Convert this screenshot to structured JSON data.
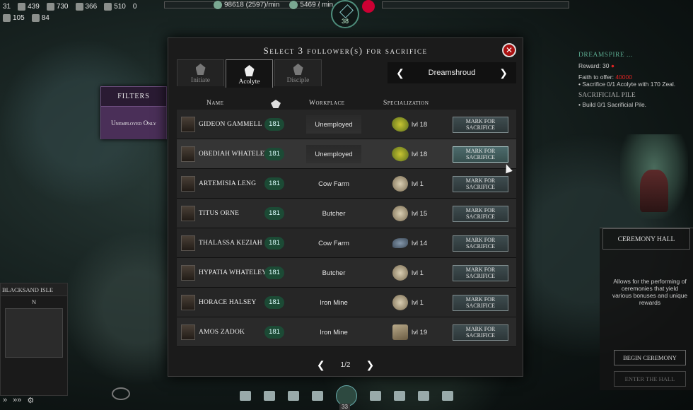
{
  "resources": {
    "r1": "31",
    "r2": "439",
    "r3": "730",
    "r4": "366",
    "r5": "510",
    "r6": "0",
    "r7": "105",
    "r8": "84",
    "income1": "98618 (2597)/min",
    "income2": "5469 / min",
    "compass_value": "38"
  },
  "dialog": {
    "title": "Select 3 follower(s) for sacrifice",
    "close_icon": "close-icon",
    "tabs": [
      {
        "label": "Initiate"
      },
      {
        "label": "Acolyte"
      },
      {
        "label": "Disciple"
      }
    ],
    "region": "Dreamshroud",
    "columns": {
      "name": "Name",
      "workplace": "Workplace",
      "specialization": "Specialization"
    },
    "mark_label": "Mark for Sacrifice",
    "rows": [
      {
        "name": "Gideon Gammell",
        "zeal": "181",
        "workplace": "Unemployed",
        "spec_icon": "corn",
        "level": "lvl 18"
      },
      {
        "name": "Obediah Whateley",
        "zeal": "181",
        "workplace": "Unemployed",
        "spec_icon": "corn",
        "level": "lvl 18"
      },
      {
        "name": "Artemisia Leng",
        "zeal": "181",
        "workplace": "Cow Farm",
        "spec_icon": "ore",
        "level": "lvl 1"
      },
      {
        "name": "Titus Orne",
        "zeal": "181",
        "workplace": "Butcher",
        "spec_icon": "ore",
        "level": "lvl 15"
      },
      {
        "name": "Thalassa Keziah",
        "zeal": "181",
        "workplace": "Cow Farm",
        "spec_icon": "fish",
        "level": "lvl 14"
      },
      {
        "name": "Hypatia Whateley",
        "zeal": "181",
        "workplace": "Butcher",
        "spec_icon": "ore",
        "level": "lvl 1"
      },
      {
        "name": "Horace Halsey",
        "zeal": "181",
        "workplace": "Iron Mine",
        "spec_icon": "ore",
        "level": "lvl 1"
      },
      {
        "name": "Amos Zadok",
        "zeal": "181",
        "workplace": "Iron Mine",
        "spec_icon": "wood",
        "level": "lvl 19"
      }
    ],
    "page": "1/2"
  },
  "filters": {
    "title": "Filters",
    "option": "Unemployed Only"
  },
  "quest": {
    "title": "DREAMSPIRE ...",
    "reward": "Reward: 30",
    "faith_label": "Faith to offer:",
    "faith_value": "40000",
    "sacrifice_line": "• Sacrifice 0/1 Acolyte with 170 Zeal.",
    "pile_title": "SACRIFICIAL PILE",
    "pile_line": "• Build 0/1 Sacrificial Pile."
  },
  "ceremony": {
    "title": "Ceremony Hall",
    "desc": "Allows for the performing of ceremonies that yield various bonuses and unique rewards",
    "begin": "Begin Ceremony",
    "enter": "Enter the Hall"
  },
  "minimap": {
    "title": "Blacksand Isle",
    "north": "N"
  },
  "bottom": {
    "center_badge": "33"
  }
}
